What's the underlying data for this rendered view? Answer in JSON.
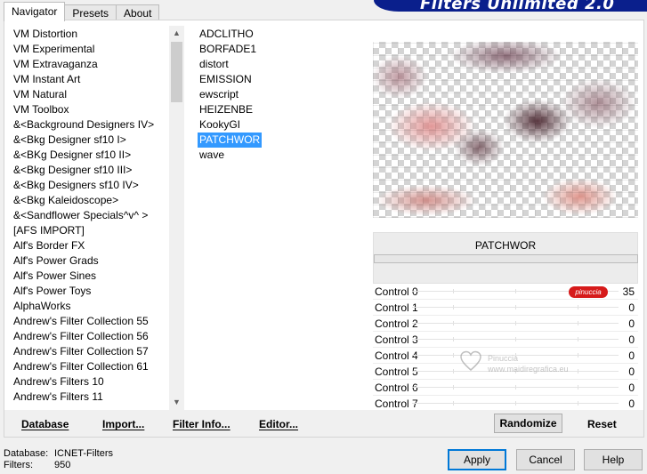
{
  "tabs": [
    {
      "label": "Navigator",
      "active": true
    },
    {
      "label": "Presets",
      "active": false
    },
    {
      "label": "About",
      "active": false
    }
  ],
  "brand": {
    "title": "Filters Unlimited 2.0"
  },
  "categories": [
    "VM Distortion",
    "VM Experimental",
    "VM Extravaganza",
    "VM Instant Art",
    "VM Natural",
    "VM Toolbox",
    "&<Background Designers IV>",
    "&<Bkg Designer sf10 I>",
    "&<BKg Designer sf10 II>",
    "&<Bkg Designer sf10 III>",
    "&<Bkg Designers sf10 IV>",
    "&<Bkg Kaleidoscope>",
    "&<Sandflower Specials^v^ >",
    "[AFS IMPORT]",
    "Alf's Border FX",
    "Alf's Power Grads",
    "Alf's Power Sines",
    "Alf's Power Toys",
    "AlphaWorks",
    "Andrew's Filter Collection 55",
    "Andrew's Filter Collection 56",
    "Andrew's Filter Collection 57",
    "Andrew's Filter Collection 61",
    "Andrew's Filters 10",
    "Andrew's Filters 11"
  ],
  "filters": [
    {
      "label": "ADCLITHO",
      "selected": false
    },
    {
      "label": "BORFADE1",
      "selected": false
    },
    {
      "label": "distort",
      "selected": false
    },
    {
      "label": "EMISSION",
      "selected": false
    },
    {
      "label": "ewscript",
      "selected": false
    },
    {
      "label": "HEIZENBE",
      "selected": false
    },
    {
      "label": "KookyGI",
      "selected": false
    },
    {
      "label": "PATCHWOR",
      "selected": true
    },
    {
      "label": "wave",
      "selected": false
    }
  ],
  "selected_filter": "PATCHWOR",
  "controls": [
    {
      "label": "Control 0",
      "value": "35"
    },
    {
      "label": "Control 1",
      "value": "0"
    },
    {
      "label": "Control 2",
      "value": "0"
    },
    {
      "label": "Control 3",
      "value": "0"
    },
    {
      "label": "Control 4",
      "value": "0"
    },
    {
      "label": "Control 5",
      "value": "0"
    },
    {
      "label": "Control 6",
      "value": "0"
    },
    {
      "label": "Control 7",
      "value": "0"
    }
  ],
  "pinuccia_tag": "pinuccia",
  "watermark": {
    "line1": "Pinuccia",
    "line2": "www.maidiregrafica.eu"
  },
  "bottom_links": {
    "database": "Database",
    "import": "Import...",
    "filter_info": "Filter Info...",
    "editor": "Editor..."
  },
  "buttons": {
    "randomize": "Randomize",
    "reset": "Reset",
    "apply": "Apply",
    "cancel": "Cancel",
    "help": "Help"
  },
  "database_info": {
    "database_label": "Database:",
    "database_value": "ICNET-Filters",
    "filters_label": "Filters:",
    "filters_value": "950"
  },
  "colors": {
    "selection": "#3399ff",
    "brand": "#0a1f8c",
    "tag": "#d61a1a",
    "default_button_border": "#0078d7"
  },
  "icons": [
    "scroll-up-icon",
    "scroll-down-icon",
    "heart-watermark-icon"
  ]
}
